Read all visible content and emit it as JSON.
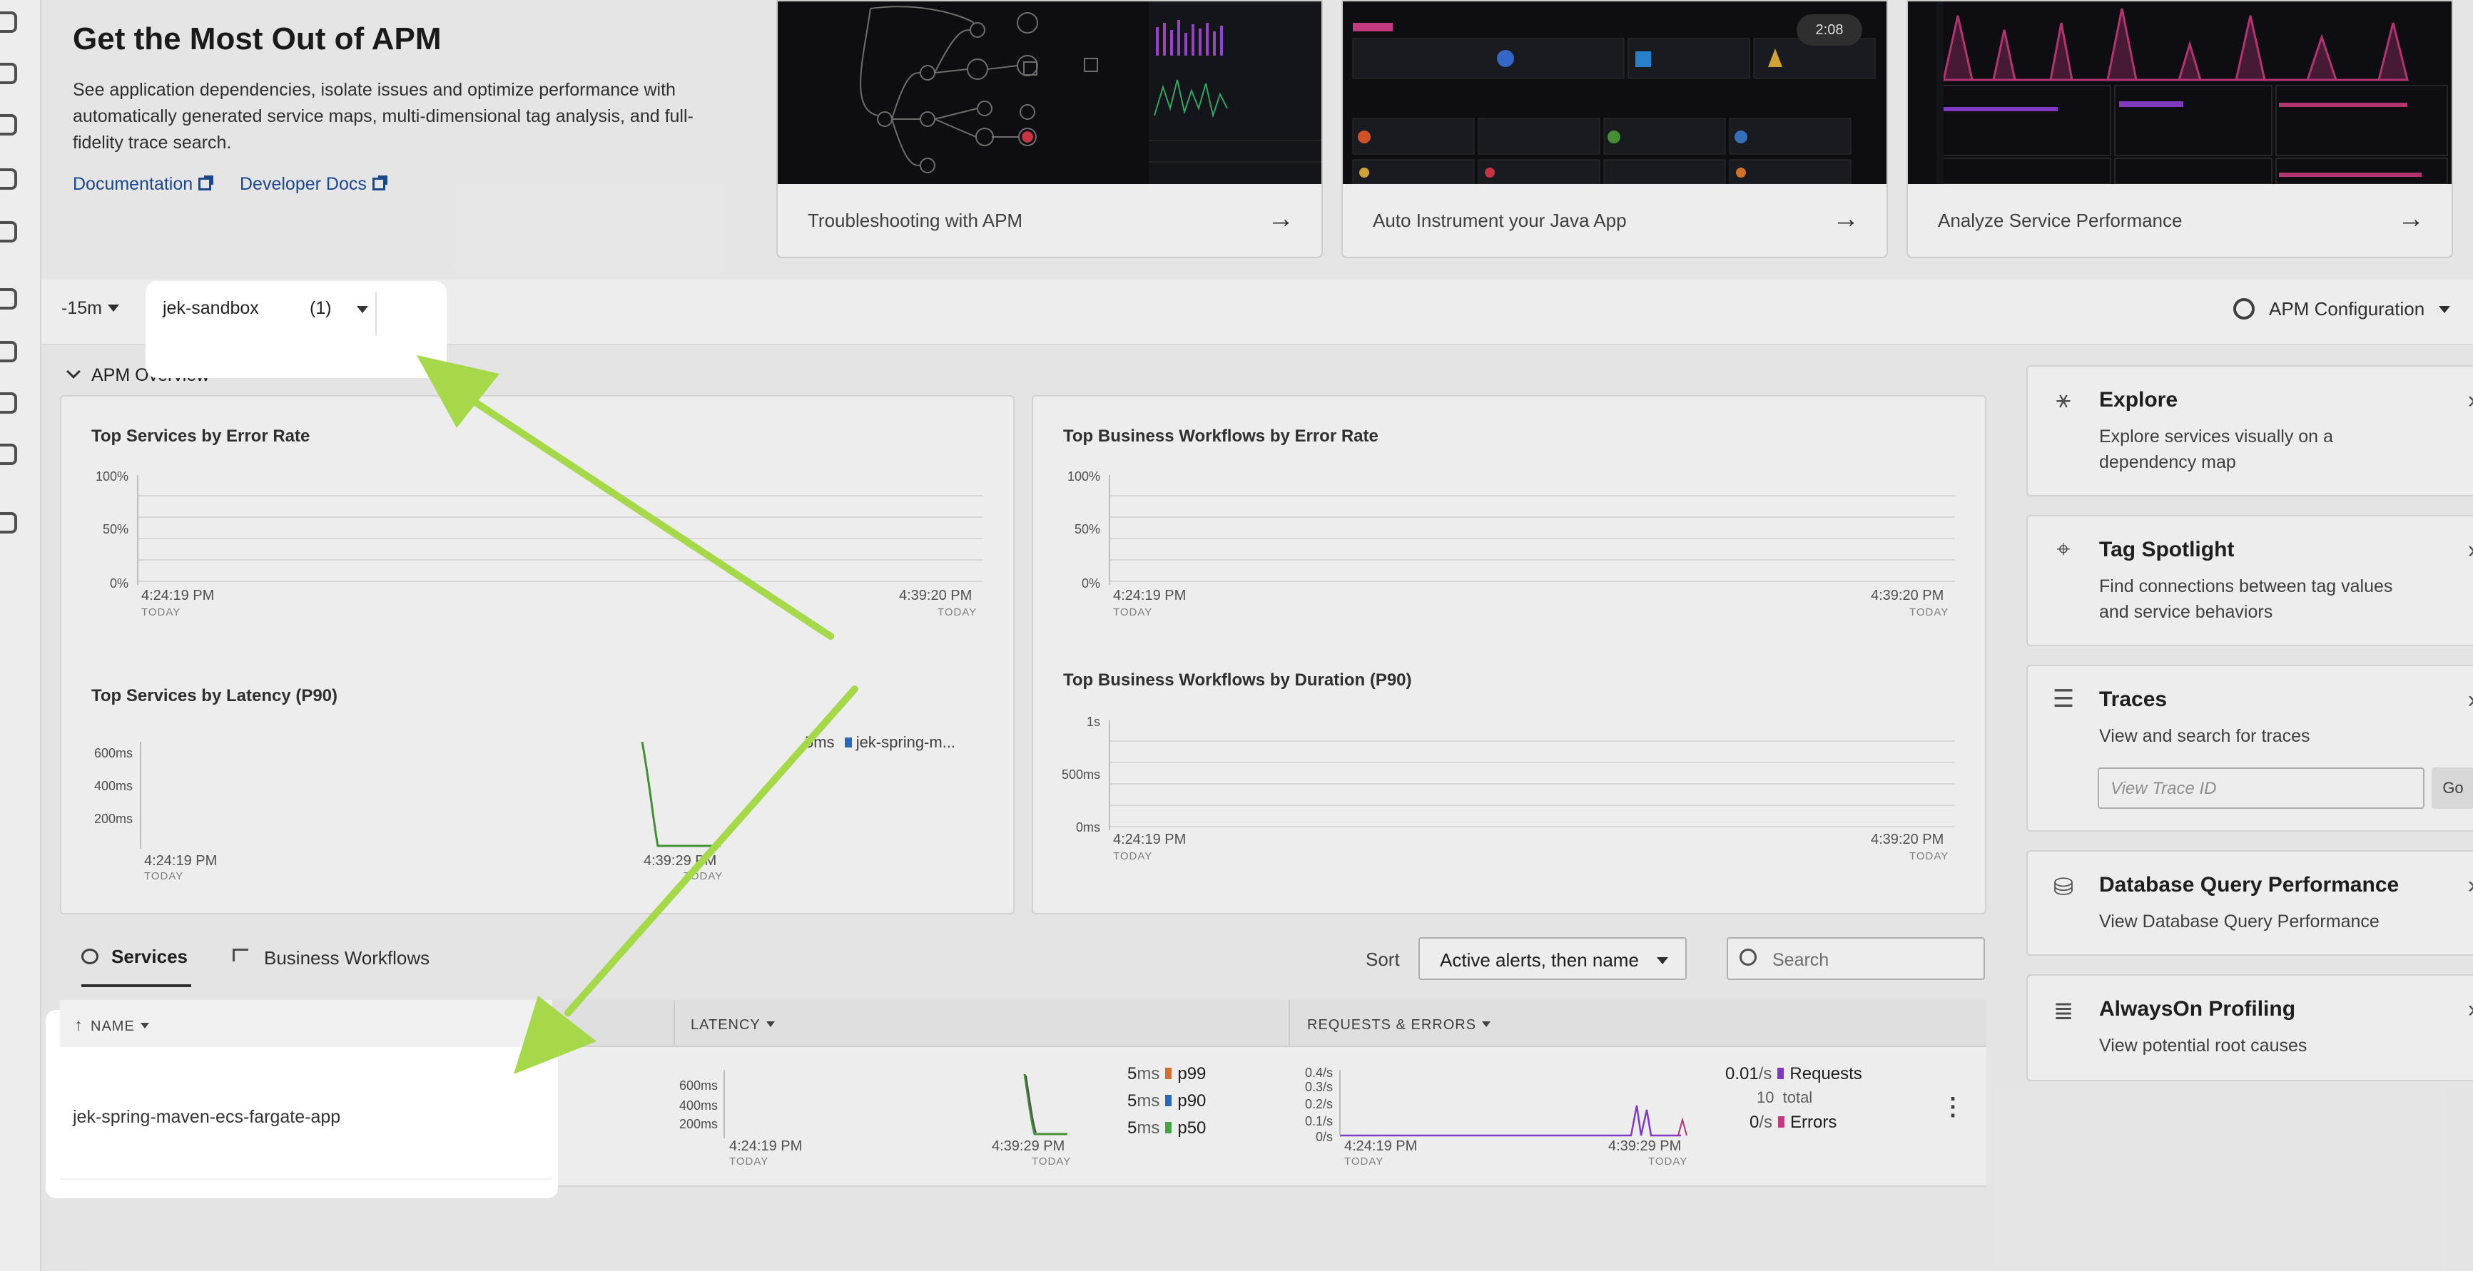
{
  "hero": {
    "title": "Get the Most Out of APM",
    "description": "See application dependencies, isolate issues and optimize performance with automatically generated service maps, multi-dimensional tag analysis, and full-fidelity trace search.",
    "links": [
      "Documentation",
      "Developer Docs"
    ],
    "cards": [
      {
        "label": "Troubleshooting with APM"
      },
      {
        "label": "Auto Instrument your Java App",
        "badge": "2:08"
      },
      {
        "label": "Analyze Service Performance"
      }
    ]
  },
  "toolbar": {
    "time_range": "-15m",
    "environment": "jek-sandbox",
    "environment_count": "(1)",
    "apm_config": "APM Configuration"
  },
  "overview": {
    "label": "APM Overview",
    "charts": {
      "error_rate_title": "Top Services by Error Rate",
      "bw_error_title": "Top Business Workflows by Error Rate",
      "latency_title": "Top Services by Latency (P90)",
      "bw_duration_title": "Top Business Workflows by Duration (P90)",
      "pct_ticks": [
        "100%",
        "50%",
        "0%"
      ],
      "latency_ticks": [
        "600ms",
        "400ms",
        "200ms"
      ],
      "duration_ticks": [
        "1s",
        "500ms",
        "0ms"
      ],
      "t_start": "4:24:19 PM",
      "t_end": "4:39:20 PM",
      "t_end_latency": "4:39:29 PM",
      "today": "TODAY",
      "legend_value": "5ms",
      "legend_name": "jek-spring-m..."
    }
  },
  "services": {
    "tabs": [
      "Services",
      "Business Workflows"
    ],
    "sort_label": "Sort",
    "sort_value": "Active alerts, then name",
    "search_placeholder": "Search",
    "columns": [
      "NAME",
      "LATENCY",
      "REQUESTS & ERRORS"
    ],
    "row": {
      "name": "jek-spring-maven-ecs-fargate-app",
      "latency_ticks": [
        "600ms",
        "400ms",
        "200ms"
      ],
      "latency_t_start": "4:24:19 PM",
      "latency_t_end": "4:39:29 PM",
      "today": "TODAY",
      "p99": {
        "value": "5",
        "unit": "ms",
        "label": "p99"
      },
      "p90": {
        "value": "5",
        "unit": "ms",
        "label": "p90"
      },
      "p50": {
        "value": "5",
        "unit": "ms",
        "label": "p50"
      },
      "req_ticks": [
        "0.4/s",
        "0.3/s",
        "0.2/s",
        "0.1/s",
        "0/s"
      ],
      "requests": {
        "value": "0.01",
        "unit": "/s",
        "label": "Requests"
      },
      "total": {
        "value": "10",
        "label": "total"
      },
      "errors": {
        "value": "0",
        "unit": "/s",
        "label": "Errors"
      }
    }
  },
  "sidebar": {
    "explore": {
      "title": "Explore",
      "desc": "Explore services visually on a dependency map"
    },
    "tag_spotlight": {
      "title": "Tag Spotlight",
      "desc": "Find connections between tag values and service behaviors"
    },
    "traces": {
      "title": "Traces",
      "desc": "View and search for traces",
      "placeholder": "View Trace ID",
      "go": "Go"
    },
    "db_query": {
      "title": "Database Query Performance",
      "desc": "View Database Query Performance"
    },
    "profiling": {
      "title": "AlwaysOn Profiling",
      "desc": "View potential root causes"
    }
  },
  "colors": {
    "arrow": "#a6d94a",
    "p99": "#e8742b",
    "p90": "#2f6fd0",
    "p50": "#4caf50",
    "requests": "#8a3fd1",
    "errors": "#d23f8a"
  }
}
